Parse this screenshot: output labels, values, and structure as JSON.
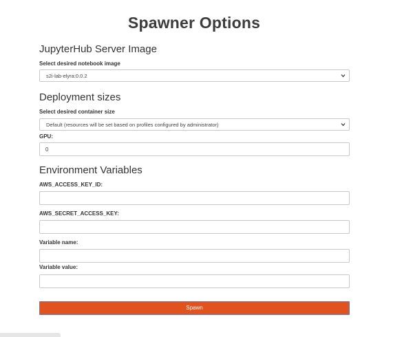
{
  "page": {
    "title": "Spawner Options"
  },
  "image_section": {
    "title": "JupyterHub Server Image",
    "select_label": "Select desired notebook image",
    "selected_image": "s2i-lab-elyra:0.0.2"
  },
  "deployment_section": {
    "title": "Deployment sizes",
    "select_label": "Select desired container size",
    "selected_size": "Default (resources will be set based on profiles configured by administrator)",
    "gpu_label": "GPU:",
    "gpu_value": "0"
  },
  "env_section": {
    "title": "Environment Variables",
    "access_key_label": "AWS_ACCESS_KEY_ID:",
    "access_key_value": "",
    "secret_key_label": "AWS_SECRET_ACCESS_KEY:",
    "secret_key_value": "",
    "var_name_label": "Variable name:",
    "var_name_value": "",
    "var_value_label": "Variable value:",
    "var_value_value": ""
  },
  "actions": {
    "spawn_label": "Spawn"
  },
  "colors": {
    "spawn_button": "#e0521e",
    "spawn_border": "#6a7fa8"
  },
  "icons": {
    "select_arrow": "chevron-down-icon"
  }
}
